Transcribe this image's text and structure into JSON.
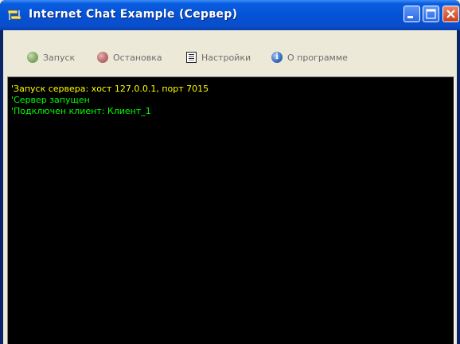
{
  "window": {
    "title": "Internet Chat Example (Сервер)",
    "app_icon": "chat-app-icon",
    "controls": {
      "minimize_icon": "minimize-icon",
      "maximize_icon": "maximize-icon",
      "close_icon": "close-icon"
    }
  },
  "toolbar": {
    "start": {
      "label": "Запуск",
      "icon": "green-dot-icon"
    },
    "stop": {
      "label": "Остановка",
      "icon": "red-dot-icon"
    },
    "settings": {
      "label": "Настройки",
      "icon": "settings-list-icon"
    },
    "about": {
      "label": "О программе",
      "icon": "info-icon"
    }
  },
  "console": {
    "lines": [
      {
        "text": "'Запуск сервера: хост 127.0.0.1, порт 7015",
        "color": "#ffff00"
      },
      {
        "text": "'Сервер запущен",
        "color": "#00ff00"
      },
      {
        "text": "'Подключен клиент: Клиент_1",
        "color": "#00ff00"
      }
    ]
  },
  "colors": {
    "titlebar": "#0353d6",
    "console_bg": "#000000",
    "toolbar_text_disabled": "#6e6e6e"
  }
}
